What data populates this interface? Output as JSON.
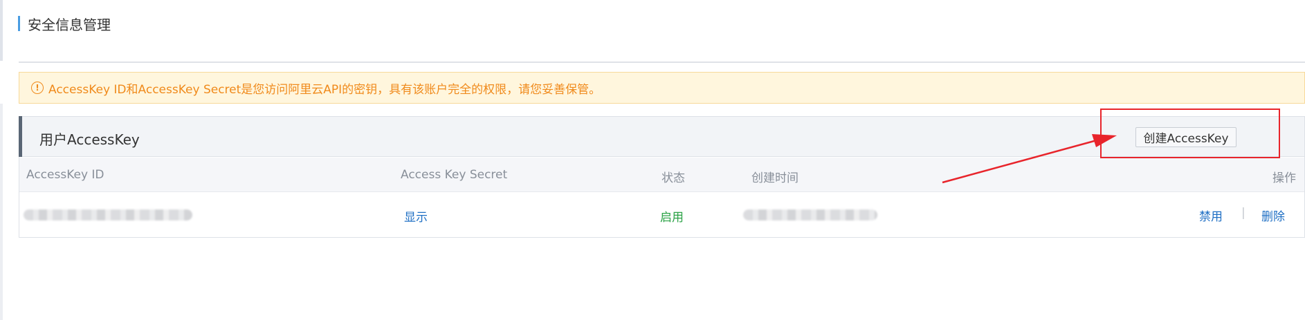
{
  "page": {
    "title": "安全信息管理"
  },
  "notice": {
    "icon": "exclamation-circle-icon",
    "text": "AccessKey ID和AccessKey Secret是您访问阿里云API的密钥，具有该账户完全的权限，请您妥善保管。",
    "color": "#f08a1b"
  },
  "panel": {
    "title": "用户AccessKey",
    "create_button_label": "创建AccessKey"
  },
  "table": {
    "columns": [
      "AccessKey ID",
      "Access Key Secret",
      "状态",
      "创建时间",
      "操作"
    ],
    "rows": [
      {
        "secret_action": "显示",
        "status": "启用",
        "actions": [
          "禁用",
          "删除"
        ],
        "action_separator": "|"
      }
    ]
  },
  "colors": {
    "accent": "#4a9de2",
    "link": "#1f6fc4",
    "status_enabled": "#2aa245",
    "annotation": "#e8242b"
  }
}
